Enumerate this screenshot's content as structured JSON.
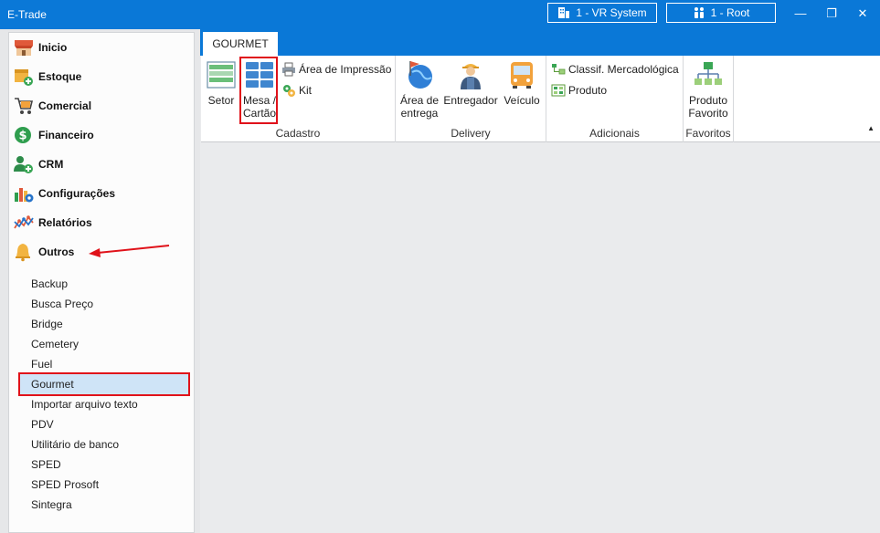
{
  "window": {
    "title": "E-Trade",
    "company_label": "1 - VR System",
    "user_label": "1 - Root",
    "minimize_glyph": "—",
    "maximize_glyph": "❐",
    "close_glyph": "✕"
  },
  "sidebar": {
    "main_items": [
      {
        "label": "Inicio",
        "icon": "store-icon"
      },
      {
        "label": "Estoque",
        "icon": "box-add-icon"
      },
      {
        "label": "Comercial",
        "icon": "cart-icon"
      },
      {
        "label": "Financeiro",
        "icon": "dollar-icon"
      },
      {
        "label": "CRM",
        "icon": "user-add-icon"
      },
      {
        "label": "Configurações",
        "icon": "chart-gear-icon"
      },
      {
        "label": "Relatórios",
        "icon": "line-chart-icon"
      },
      {
        "label": "Outros",
        "icon": "bell-icon"
      }
    ],
    "sub_items": [
      "Backup",
      "Busca Preço",
      "Bridge",
      "Cemetery",
      "Fuel",
      "Gourmet",
      "Importar arquivo texto",
      "PDV",
      "Utilitário de banco",
      "SPED",
      "SPED Prosoft",
      "Sintegra"
    ],
    "selected_sub_item": "Gourmet"
  },
  "ribbon": {
    "tab_label": "GOURMET",
    "groups": {
      "cadastro": {
        "label": "Cadastro",
        "setor": "Setor",
        "mesa_line1": "Mesa /",
        "mesa_line2": "Cartão",
        "area_impressao": "Área de Impressão",
        "kit": "Kit"
      },
      "delivery": {
        "label": "Delivery",
        "area_line1": "Área de",
        "area_line2": "entrega",
        "entregador": "Entregador",
        "veiculo": "Veículo"
      },
      "adicionais": {
        "label": "Adicionais",
        "classif": "Classif. Mercadológica",
        "produto": "Produto"
      },
      "favoritos": {
        "label": "Favoritos",
        "produto_line1": "Produto",
        "produto_line2": "Favorito"
      }
    },
    "collapse_glyph": "▲"
  },
  "colors": {
    "accent": "#0a78d7",
    "selection": "#cfe4f7",
    "highlight_annotation": "#e0121a"
  }
}
